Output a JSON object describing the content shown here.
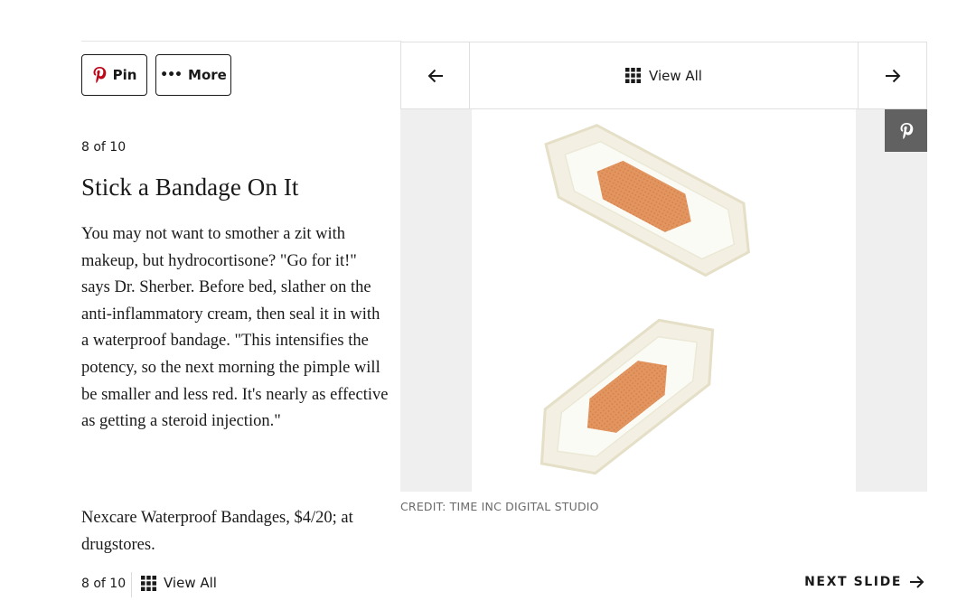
{
  "share": {
    "pin_label": "Pin",
    "more_label": "More"
  },
  "slide": {
    "counter": "8 of 10",
    "title": "Stick a Bandage On It",
    "body": "You may not want to smother a zit with makeup, but hydrocortisone? \"Go for it!\" says Dr. Sherber. Before bed, slather on the anti-inflammatory cream, then seal it in with a waterproof bandage. \"This intensifies the potency, so the next morning the pimple will be smaller and less red. It's nearly as effective as getting a steroid injection.\"",
    "product": "Nexcare Waterproof Bandages, $4/20; at drugstores."
  },
  "nav": {
    "view_all_label": "View All",
    "prev_icon": "arrow-left-icon",
    "next_icon": "arrow-right-icon"
  },
  "image": {
    "credit": "CREDIT: TIME INC DIGITAL STUDIO",
    "subject": "two waterproof bandages"
  },
  "footer": {
    "counter": "8 of 10",
    "view_all_label": "View All",
    "next_slide_label": "NEXT SLIDE"
  },
  "colors": {
    "pinterest_red": "#bd081c",
    "pin_overlay_bg": "#616161",
    "bandage_pad": "#e49a6a"
  }
}
